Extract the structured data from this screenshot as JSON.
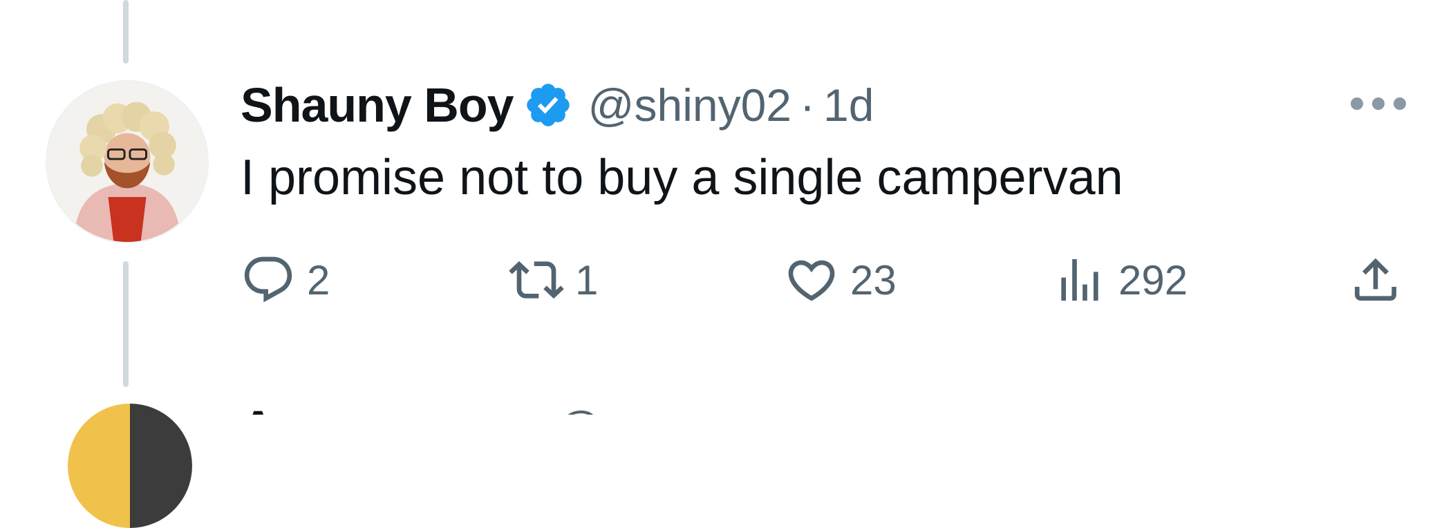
{
  "tweet": {
    "author_name": "Shauny Boy",
    "verified_icon": "verified-badge-icon",
    "handle": "@shiny02",
    "separator": "·",
    "time": "1d",
    "text": "I promise not to buy a single campervan",
    "more_icon": "more-options-icon",
    "actions": {
      "reply": {
        "icon": "reply-icon",
        "count": "2"
      },
      "retweet": {
        "icon": "retweet-icon",
        "count": "1"
      },
      "like": {
        "icon": "heart-icon",
        "count": "23"
      },
      "views": {
        "icon": "views-chart-icon",
        "count": "292"
      },
      "share": {
        "icon": "share-icon"
      }
    }
  },
  "next_tweet": {
    "author_name": "A",
    "handle": "@"
  },
  "colors": {
    "verified": "#1d9bf0",
    "text_primary": "#0f1419",
    "text_secondary": "#536471",
    "thread_line": "#cfd9de"
  }
}
